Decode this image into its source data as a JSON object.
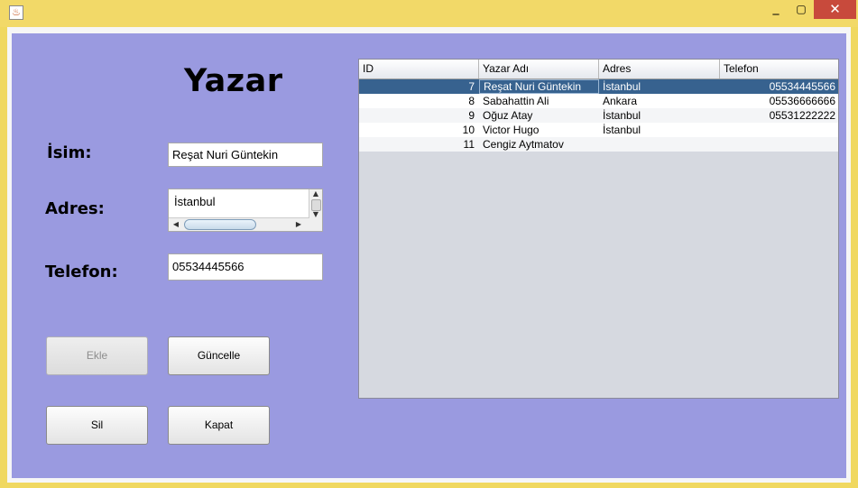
{
  "window": {
    "min_icon": "minimize-icon",
    "max_icon": "maximize-icon",
    "close_icon": "close-icon",
    "app_icon": "java-icon",
    "min_glyph": "_",
    "max_glyph": "▢",
    "close_glyph": "✕",
    "app_glyph": "♨"
  },
  "form": {
    "heading": "Yazar",
    "name_label": "İsim:",
    "name_value": "Reşat Nuri Güntekin",
    "address_label": "Adres:",
    "address_value": "İstanbul",
    "phone_label": "Telefon:",
    "phone_value": "05534445566"
  },
  "buttons": {
    "add": "Ekle",
    "update": "Güncelle",
    "delete": "Sil",
    "close": "Kapat"
  },
  "table": {
    "columns": [
      "ID",
      "Yazar Adı",
      "Adres",
      "Telefon"
    ],
    "rows": [
      {
        "id": "7",
        "name": "Reşat Nuri Güntekin",
        "address": "İstanbul",
        "phone": "05534445566",
        "selected": true
      },
      {
        "id": "8",
        "name": "Sabahattin Ali",
        "address": "Ankara",
        "phone": "05536666666"
      },
      {
        "id": "9",
        "name": "Oğuz Atay",
        "address": "İstanbul",
        "phone": "05531222222"
      },
      {
        "id": "10",
        "name": "Victor Hugo",
        "address": "İstanbul",
        "phone": ""
      },
      {
        "id": "11",
        "name": "Cengiz Aytmatov",
        "address": "",
        "phone": ""
      }
    ]
  },
  "colors": {
    "panel_bg": "#9a9ae0",
    "title_bar": "#f2d968",
    "selection": "#37628f",
    "close_button": "#c84a3c"
  }
}
